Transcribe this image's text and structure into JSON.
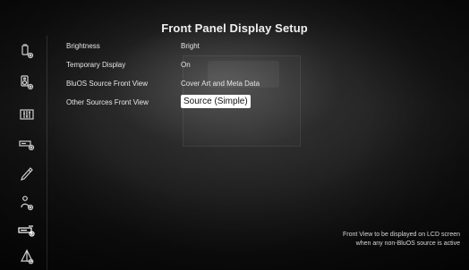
{
  "header": {
    "title": "Front Panel Display Setup"
  },
  "sidebar": {
    "items": [
      {
        "icon": "amp-gear-icon",
        "active": false
      },
      {
        "icon": "speaker-gear-icon",
        "active": false
      },
      {
        "icon": "equalizer-icon",
        "active": false
      },
      {
        "icon": "receiver-gear-icon",
        "active": false
      },
      {
        "icon": "pen-icon",
        "active": false
      },
      {
        "icon": "person-gear-icon",
        "active": false
      },
      {
        "icon": "front-panel-gear-icon",
        "active": true
      },
      {
        "icon": "network-gear-icon",
        "active": false
      }
    ]
  },
  "settings": [
    {
      "label": "Brightness",
      "value": "Bright",
      "selected": false
    },
    {
      "label": "Temporary Display",
      "value": "On",
      "selected": false
    },
    {
      "label": "BluOS Source Front View",
      "value": "Cover Art and Meta Data",
      "selected": false
    },
    {
      "label": "Other Sources Front View",
      "value": "Source (Simple)",
      "selected": true
    }
  ],
  "help": {
    "line1": "Front View to be displayed on LCD screen",
    "line2": "when any non-BluOS source is active"
  }
}
